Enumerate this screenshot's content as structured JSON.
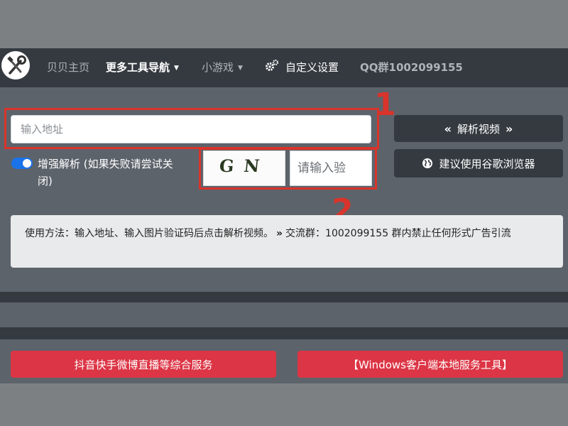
{
  "nav": {
    "home": "贝贝主页",
    "tools": "更多工具导航",
    "games": "小游戏",
    "settings": "自定义设置",
    "qq_group": "QQ群1002099155"
  },
  "form": {
    "address_placeholder": "输入地址",
    "parse_button": "解析视频",
    "browser_button": "建议使用谷歌浏览器",
    "enhance_label": "增强解析 (如果失败请尝试关闭)",
    "captcha_text": "GN",
    "captcha_placeholder": "请输入验"
  },
  "annotations": {
    "marker_1": "1",
    "marker_2": "2",
    "highlight_color": "#d9342b"
  },
  "info": {
    "usage": "使用方法：输入地址、输入图片验证码后点击解析视频。",
    "separator": "»",
    "group": "交流群：1002099155 群内禁止任何形式广告引流"
  },
  "footer_buttons": {
    "left": "抖音快手微博直播等综合服务",
    "right": "【Windows客户端本地服务工具】"
  },
  "colors": {
    "navbar": "#343a40",
    "accent_red": "#dc3545",
    "toggle": "#1a73e8"
  },
  "icons": {
    "logo": "tools-logo-icon",
    "settings": "gears-icon",
    "parse_left": "double-chevron-left-icon",
    "parse_right": "double-chevron-right-icon",
    "browser": "globe-icon"
  }
}
